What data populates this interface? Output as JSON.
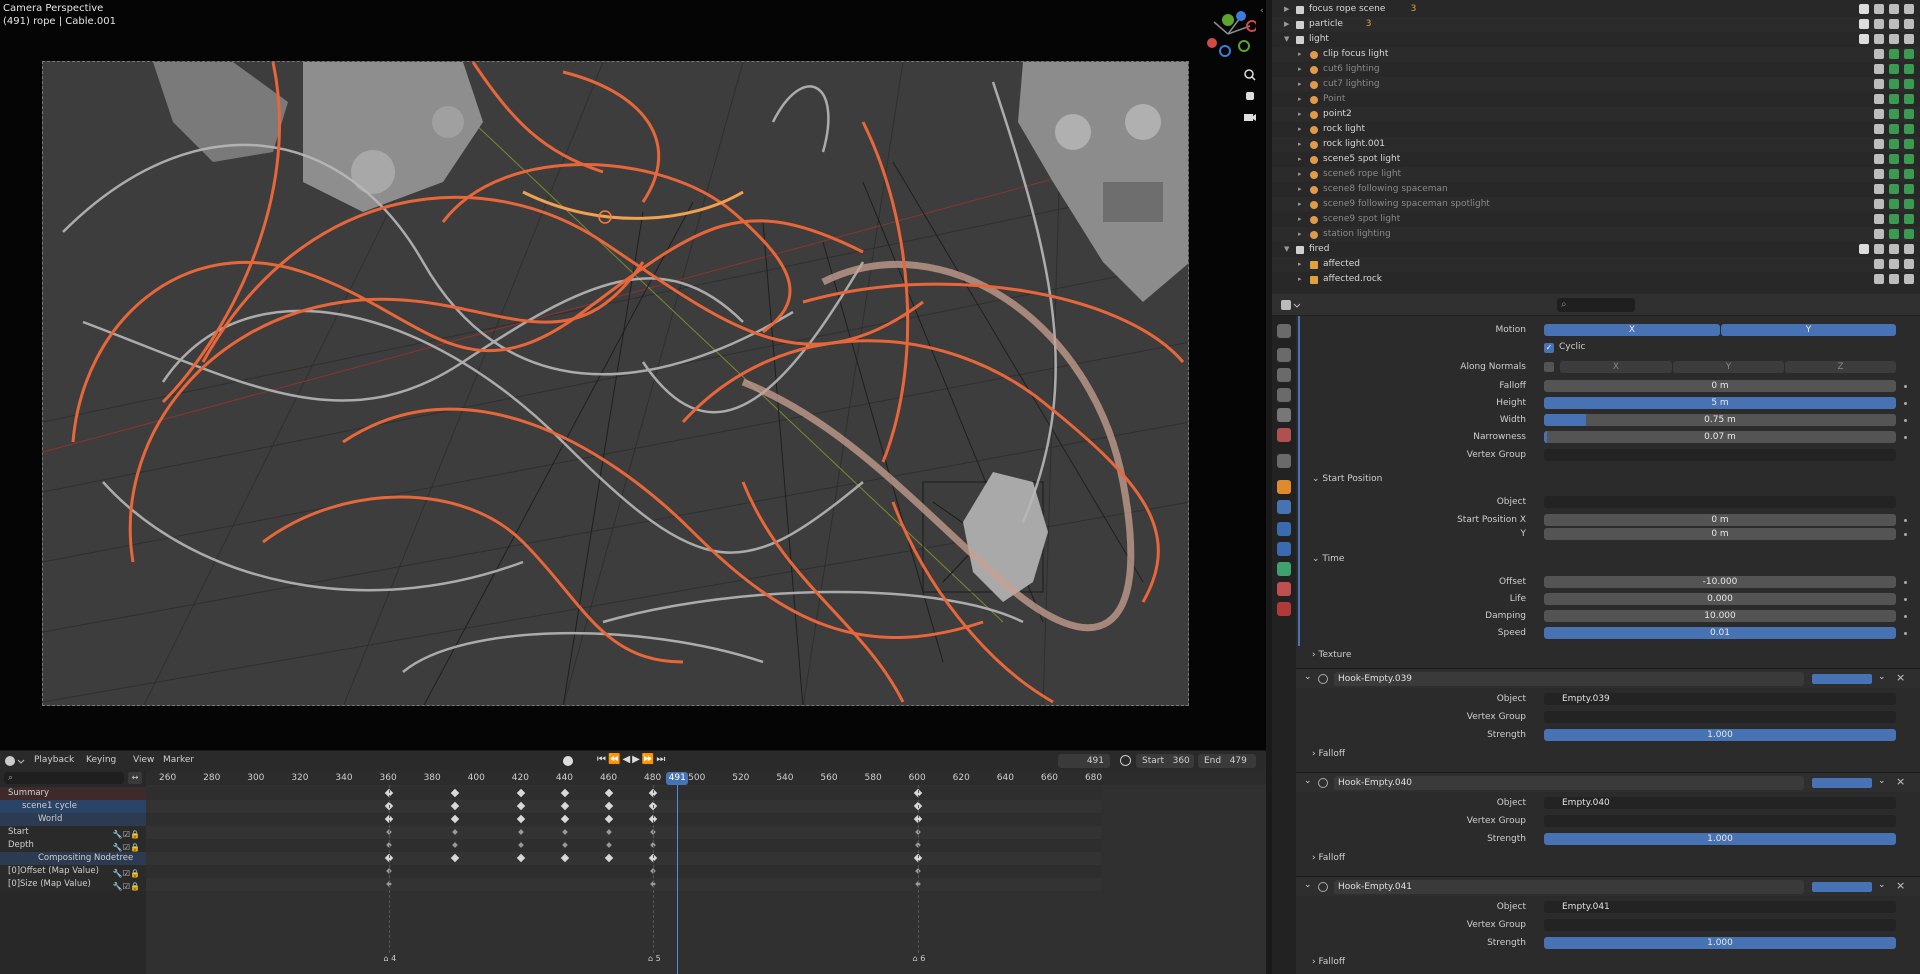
{
  "viewport": {
    "title": "Camera Perspective",
    "subtitle": "(491) rope | Cable.001",
    "gizmo_axes": [
      "X",
      "Y",
      "Z"
    ]
  },
  "outliner": {
    "items": [
      {
        "label": "focus rope scene",
        "type": "collection",
        "extra": "3"
      },
      {
        "label": "particle",
        "type": "collection",
        "extra": "3"
      },
      {
        "label": "light",
        "type": "collection",
        "expanded": true
      },
      {
        "label": "clip focus light",
        "type": "light"
      },
      {
        "label": "cut6 lighting",
        "type": "light"
      },
      {
        "label": "cut7 lighting",
        "type": "light"
      },
      {
        "label": "Point",
        "type": "light"
      },
      {
        "label": "point2",
        "type": "light"
      },
      {
        "label": "rock light",
        "type": "light"
      },
      {
        "label": "rock light.001",
        "type": "light"
      },
      {
        "label": "scene5 spot light",
        "type": "light"
      },
      {
        "label": "scene6 rope light",
        "type": "light"
      },
      {
        "label": "scene8 following spaceman",
        "type": "light"
      },
      {
        "label": "scene9 following spaceman spotlight",
        "type": "light"
      },
      {
        "label": "scene9 spot light",
        "type": "light"
      },
      {
        "label": "station lighting",
        "type": "light"
      },
      {
        "label": "fired",
        "type": "collection",
        "expanded": true
      },
      {
        "label": "affected",
        "type": "armature"
      },
      {
        "label": "affected.rock",
        "type": "armature"
      }
    ]
  },
  "properties": {
    "search_placeholder": "",
    "motion_label": "Motion",
    "motion_x": "X",
    "motion_y": "Y",
    "cyclic_label": "Cyclic",
    "along_normals_label": "Along Normals",
    "along_x": "X",
    "along_y": "Y",
    "along_z": "Z",
    "falloff_label": "Falloff",
    "falloff_value": "0 m",
    "height_label": "Height",
    "height_value": "5 m",
    "width_label": "Width",
    "width_value": "0.75 m",
    "width_fraction": 0.12,
    "narrowness_label": "Narrowness",
    "narrowness_value": "0.07 m",
    "vertex_group_label": "Vertex Group",
    "start_position_section": "Start Position",
    "object_label": "Object",
    "start_x_label": "Start Position X",
    "start_x_value": "0 m",
    "start_y_label": "Y",
    "start_y_value": "0 m",
    "time_section": "Time",
    "offset_label": "Offset",
    "offset_value": "-10.000",
    "life_label": "Life",
    "life_value": "0.000",
    "damping_label": "Damping",
    "damping_value": "10.000",
    "speed_label": "Speed",
    "speed_value": "0.01",
    "texture_section": "Texture",
    "hooks": [
      {
        "name": "Hook-Empty.039",
        "object": "Empty.039",
        "strength": "1.000"
      },
      {
        "name": "Hook-Empty.040",
        "object": "Empty.040",
        "strength": "1.000"
      },
      {
        "name": "Hook-Empty.041",
        "object": "Empty.041",
        "strength": "1.000"
      }
    ],
    "hook_object_label": "Object",
    "hook_vgroup_label": "Vertex Group",
    "hook_strength_label": "Strength",
    "hook_falloff_label": "Falloff"
  },
  "timeline": {
    "menus": [
      "Playback",
      "Keying",
      "View",
      "Marker"
    ],
    "current_frame": "491",
    "start_label": "Start",
    "start_value": "360",
    "end_label": "End",
    "end_value": "479",
    "ticks": [
      "260",
      "280",
      "300",
      "320",
      "340",
      "360",
      "380",
      "400",
      "420",
      "440",
      "460",
      "480",
      "500",
      "520",
      "540",
      "560",
      "580",
      "600",
      "620",
      "640",
      "660",
      "680"
    ],
    "playhead": "491",
    "channels": [
      {
        "label": "Summary",
        "style": "summary"
      },
      {
        "label": "scene1 cycle",
        "style": "object"
      },
      {
        "label": "World",
        "style": "world"
      },
      {
        "label": "Start",
        "style": "prop"
      },
      {
        "label": "Depth",
        "style": "prop"
      },
      {
        "label": "Compositing Nodetree",
        "style": "world"
      },
      {
        "label": "[0]Offset (Map Value)",
        "style": "prop"
      },
      {
        "label": "[0]Size (Map Value)",
        "style": "prop"
      }
    ],
    "keyframe_frames": [
      360,
      390,
      420,
      440,
      460,
      480,
      600
    ],
    "markers": [
      {
        "label": "4",
        "frame": 360
      },
      {
        "label": "5",
        "frame": 480
      },
      {
        "label": "6",
        "frame": 600
      }
    ]
  },
  "colors": {
    "accent": "#4772b3",
    "rope_orange": "#e8673a",
    "rope_white": "#b8b8b8"
  }
}
